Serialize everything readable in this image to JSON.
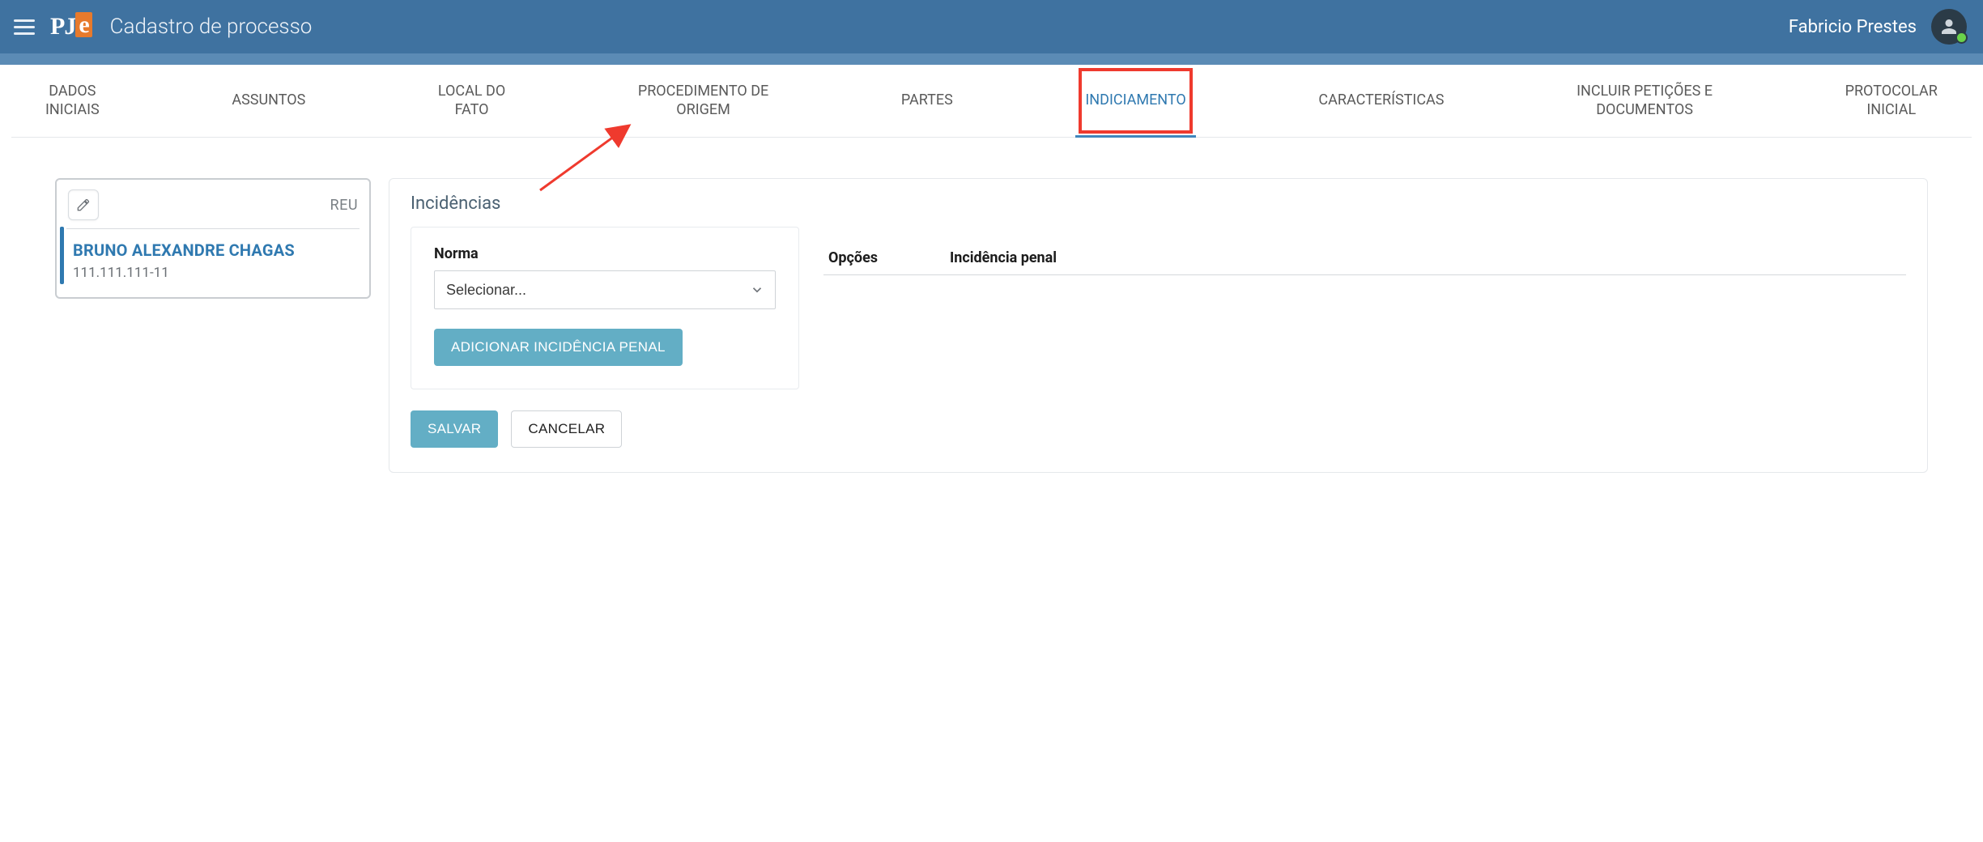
{
  "header": {
    "page_title": "Cadastro de processo",
    "user_name": "Fabricio Prestes"
  },
  "tabs": [
    {
      "label": "DADOS\nINICIAIS",
      "active": false
    },
    {
      "label": "ASSUNTOS",
      "active": false
    },
    {
      "label": "LOCAL DO\nFATO",
      "active": false
    },
    {
      "label": "PROCEDIMENTO DE\nORIGEM",
      "active": false
    },
    {
      "label": "PARTES",
      "active": false
    },
    {
      "label": "INDICIAMENTO",
      "active": true,
      "highlighted": true
    },
    {
      "label": "CARACTERÍSTICAS",
      "active": false
    },
    {
      "label": "INCLUIR PETIÇÕES E\nDOCUMENTOS",
      "active": false
    },
    {
      "label": "PROTOCOLAR\nINICIAL",
      "active": false
    }
  ],
  "party": {
    "tag": "REU",
    "name": "BRUNO ALEXANDRE CHAGAS",
    "doc": "111.111.111-11"
  },
  "incidencias": {
    "title": "Incidências",
    "form": {
      "norma_label": "Norma",
      "norma_placeholder": "Selecionar...",
      "add_button": "ADICIONAR INCIDÊNCIA PENAL"
    },
    "actions": {
      "save": "SALVAR",
      "cancel": "CANCELAR"
    },
    "table": {
      "col_options": "Opções",
      "col_incidencia": "Incidência penal"
    }
  }
}
